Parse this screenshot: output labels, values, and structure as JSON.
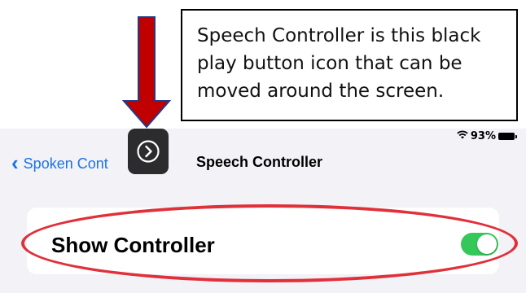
{
  "callout": {
    "text": "Speech Controller is this black play button icon that can be moved around the screen."
  },
  "status": {
    "wifi_icon": "wifi-icon",
    "battery_percent": "93%"
  },
  "nav": {
    "back_label": "Spoken Cont",
    "title": "Speech Controller"
  },
  "settings": {
    "show_controller_label": "Show Controller",
    "show_controller_on": true
  },
  "colors": {
    "toggle_on": "#34c759",
    "ios_blue": "#1a73e8",
    "annotation_red": "#e0303a",
    "arrow_red": "#c00000",
    "arrow_outline": "#1f3a8a"
  }
}
